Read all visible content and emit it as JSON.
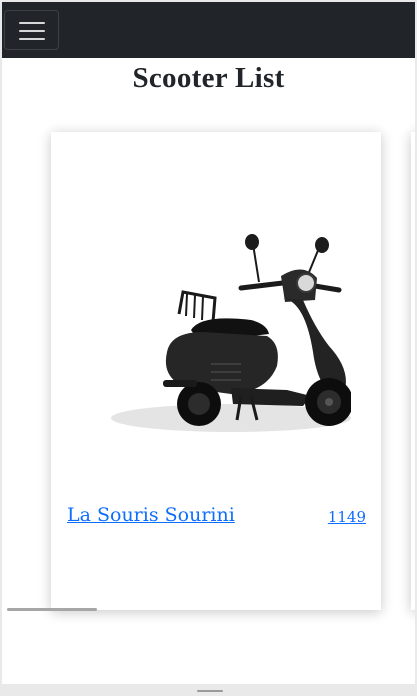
{
  "navbar": {
    "toggler_icon": "hamburger-menu-icon",
    "background_color": "#212529"
  },
  "page": {
    "title": "Scooter List"
  },
  "scooters": [
    {
      "name": "La Souris Sourini",
      "price": "1149",
      "image_icon": "black-scooter-image"
    }
  ],
  "colors": {
    "link": "#0d6efd",
    "title": "#212529",
    "card_background": "#ffffff"
  }
}
